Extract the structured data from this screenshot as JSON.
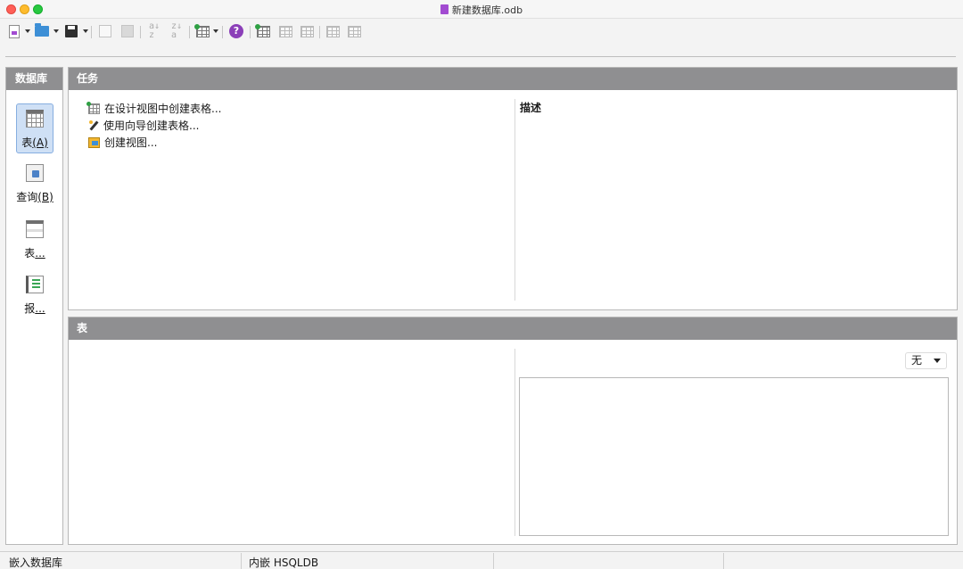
{
  "window": {
    "title": "新建数据库.odb"
  },
  "toolbar": {
    "buttons": [
      {
        "name": "new-document",
        "icon": "new-document-icon"
      },
      {
        "name": "open",
        "icon": "folder-icon"
      },
      {
        "name": "save",
        "icon": "save-icon"
      },
      {
        "name": "copy",
        "icon": "copy-icon"
      },
      {
        "name": "paste",
        "icon": "paste-icon"
      },
      {
        "name": "sort-ascending",
        "icon": "sort-ascending-icon"
      },
      {
        "name": "sort-descending",
        "icon": "sort-descending-icon"
      },
      {
        "name": "form-from-table",
        "icon": "form-icon"
      },
      {
        "name": "help",
        "icon": "help-icon",
        "glyph": "?"
      },
      {
        "name": "create-table",
        "icon": "table-icon"
      },
      {
        "name": "edit-table",
        "icon": "edit-table-icon"
      },
      {
        "name": "delete-table",
        "icon": "delete-table-icon"
      },
      {
        "name": "rename",
        "icon": "rename-icon"
      },
      {
        "name": "properties",
        "icon": "properties-icon"
      }
    ]
  },
  "sidebar": {
    "title": "数据库",
    "items": [
      {
        "label_main": "表",
        "label_mnemonic": "(A)",
        "icon": "table-icon",
        "active": true
      },
      {
        "label_main": "查询",
        "label_mnemonic": "(B)",
        "icon": "query-icon",
        "active": false
      },
      {
        "label_main": "表",
        "label_mnemonic": "...",
        "icon": "form-icon",
        "active": false
      },
      {
        "label_main": "报",
        "label_mnemonic": "...",
        "icon": "report-icon",
        "active": false
      }
    ]
  },
  "tasks": {
    "title": "任务",
    "items": [
      {
        "label": "在设计视图中创建表格...",
        "icon": "design-view-icon"
      },
      {
        "label": "使用向导创建表格...",
        "icon": "wizard-icon"
      },
      {
        "label": "创建视图...",
        "icon": "create-view-icon"
      }
    ],
    "description_label": "描述"
  },
  "tables": {
    "title": "表",
    "preview_select": {
      "value": "无"
    }
  },
  "statusbar": {
    "cells": [
      "嵌入数据库",
      "内嵌 HSQLDB",
      "",
      ""
    ]
  },
  "colors": {
    "panel_header": "#8f8f91",
    "active_nav": "#cfe0f5",
    "help_icon": "#8b3fb8"
  }
}
